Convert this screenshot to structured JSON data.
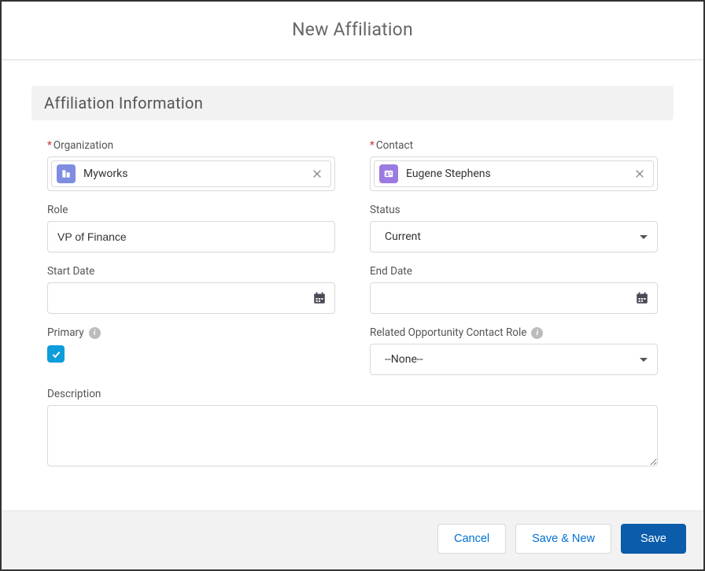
{
  "modal": {
    "title": "New Affiliation"
  },
  "section": {
    "title": "Affiliation Information"
  },
  "fields": {
    "organization": {
      "label": "Organization",
      "value": "Myworks",
      "required": true
    },
    "contact": {
      "label": "Contact",
      "value": "Eugene Stephens",
      "required": true
    },
    "role": {
      "label": "Role",
      "value": "VP of Finance"
    },
    "status": {
      "label": "Status",
      "value": "Current"
    },
    "startDate": {
      "label": "Start Date",
      "value": ""
    },
    "endDate": {
      "label": "End Date",
      "value": ""
    },
    "primary": {
      "label": "Primary",
      "checked": true
    },
    "relatedOppRole": {
      "label": "Related Opportunity Contact Role",
      "value": "--None--"
    },
    "description": {
      "label": "Description",
      "value": ""
    }
  },
  "buttons": {
    "cancel": "Cancel",
    "saveNew": "Save & New",
    "save": "Save"
  }
}
